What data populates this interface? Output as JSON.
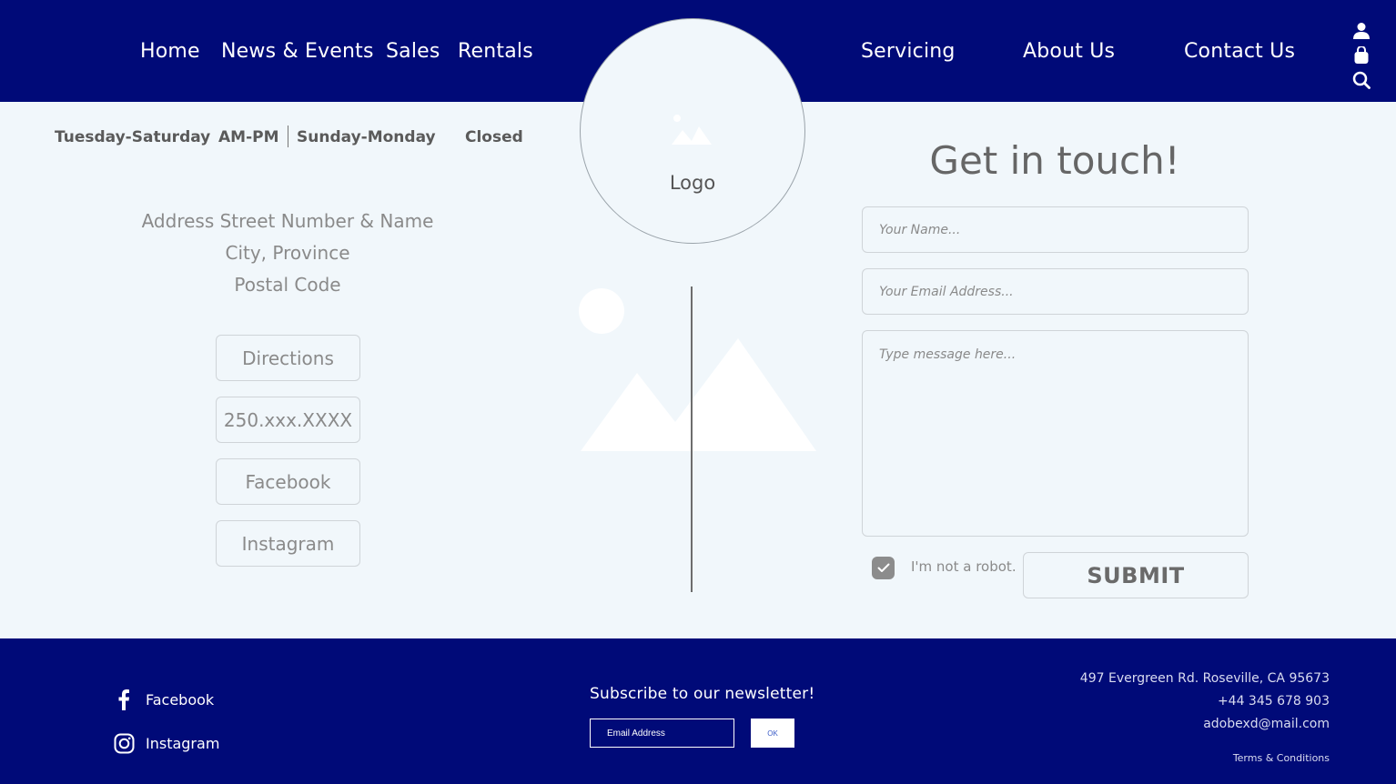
{
  "header": {
    "nav": [
      "Home",
      "News & Events",
      "Sales",
      "Rentals",
      "Servicing",
      "About Us",
      "Contact Us"
    ],
    "icons": [
      "user-icon",
      "shopping-bag-icon",
      "search-icon"
    ]
  },
  "logo": {
    "label": "Logo"
  },
  "hours": {
    "weekday_days": "Tuesday-Saturday",
    "weekday_time": "AM-PM",
    "weekend_days": "Sunday-Monday",
    "weekend_status": "Closed"
  },
  "address": {
    "line1": "Address Street Number & Name",
    "line2": "City, Province",
    "line3": "Postal Code"
  },
  "buttons": {
    "directions": "Directions",
    "phone": "250.xxx.XXXX",
    "facebook": "Facebook",
    "instagram": "Instagram"
  },
  "contact_form": {
    "title": "Get in touch!",
    "name_placeholder": "Your Name...",
    "email_placeholder": "Your Email Address...",
    "message_placeholder": "Type message here...",
    "robot_label": "I'm not a robot.",
    "robot_checked": true,
    "submit_label": "SUBMIT"
  },
  "footer": {
    "social": [
      {
        "label": "Facebook",
        "icon": "facebook-icon"
      },
      {
        "label": "Instagram",
        "icon": "instagram-icon"
      }
    ],
    "newsletter_title": "Subscribe to our newsletter!",
    "newsletter_placeholder": "Email Address",
    "newsletter_button": "OK",
    "address": "497 Evergreen Rd. Roseville, CA 95673",
    "phone": "+44 345 678 903",
    "email": "adobexd@mail.com",
    "terms": "Terms & Conditions"
  },
  "colors": {
    "brand_navy": "#000a78",
    "page_background": "#f1f7fb",
    "text_gray": "#8a8a8a"
  }
}
